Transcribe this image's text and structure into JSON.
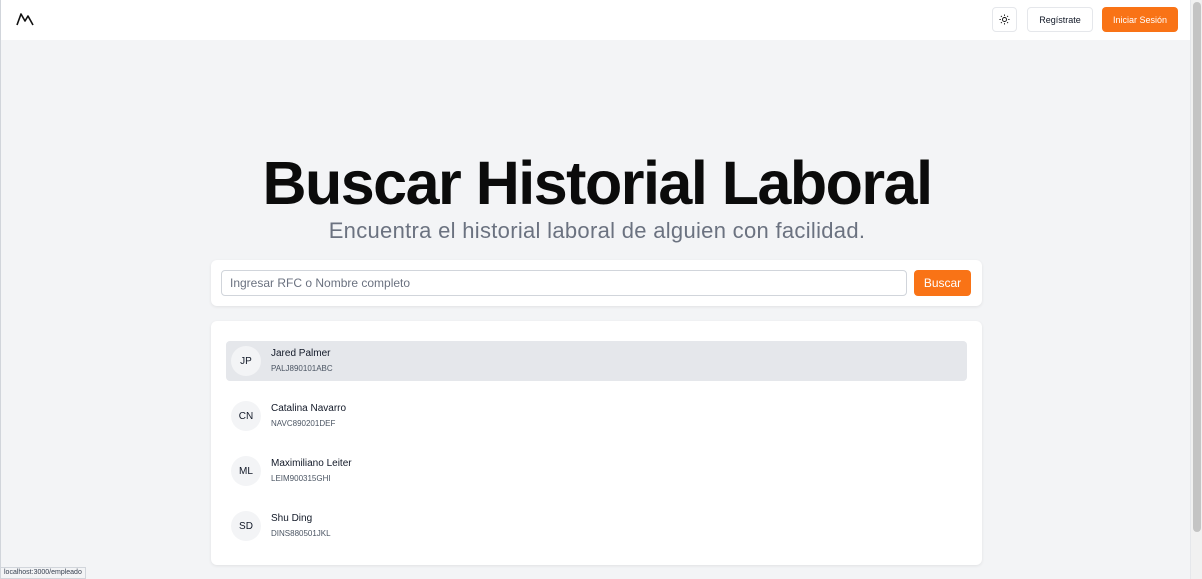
{
  "header": {
    "logo_icon": "mountain-logo-icon",
    "theme_toggle_icon": "sun-icon",
    "register_label": "Regístrate",
    "login_label": "Iniciar Sesión"
  },
  "hero": {
    "title": "Buscar Historial Laboral",
    "subtitle": "Encuentra el historial laboral de alguien con facilidad."
  },
  "search": {
    "placeholder": "Ingresar RFC o Nombre completo",
    "value": "",
    "button_label": "Buscar"
  },
  "results": [
    {
      "initials": "JP",
      "name": "Jared Palmer",
      "rfc": "PALJ890101ABC",
      "selected": true
    },
    {
      "initials": "CN",
      "name": "Catalina Navarro",
      "rfc": "NAVC890201DEF",
      "selected": false
    },
    {
      "initials": "ML",
      "name": "Maximiliano Leiter",
      "rfc": "LEIM900315GHI",
      "selected": false
    },
    {
      "initials": "SD",
      "name": "Shu Ding",
      "rfc": "DINS880501JKL",
      "selected": false
    }
  ],
  "status_bar": {
    "url": "localhost:3000/empleado"
  },
  "colors": {
    "accent": "#f97316",
    "background": "#f3f4f6",
    "selected_row": "#e5e7eb"
  }
}
